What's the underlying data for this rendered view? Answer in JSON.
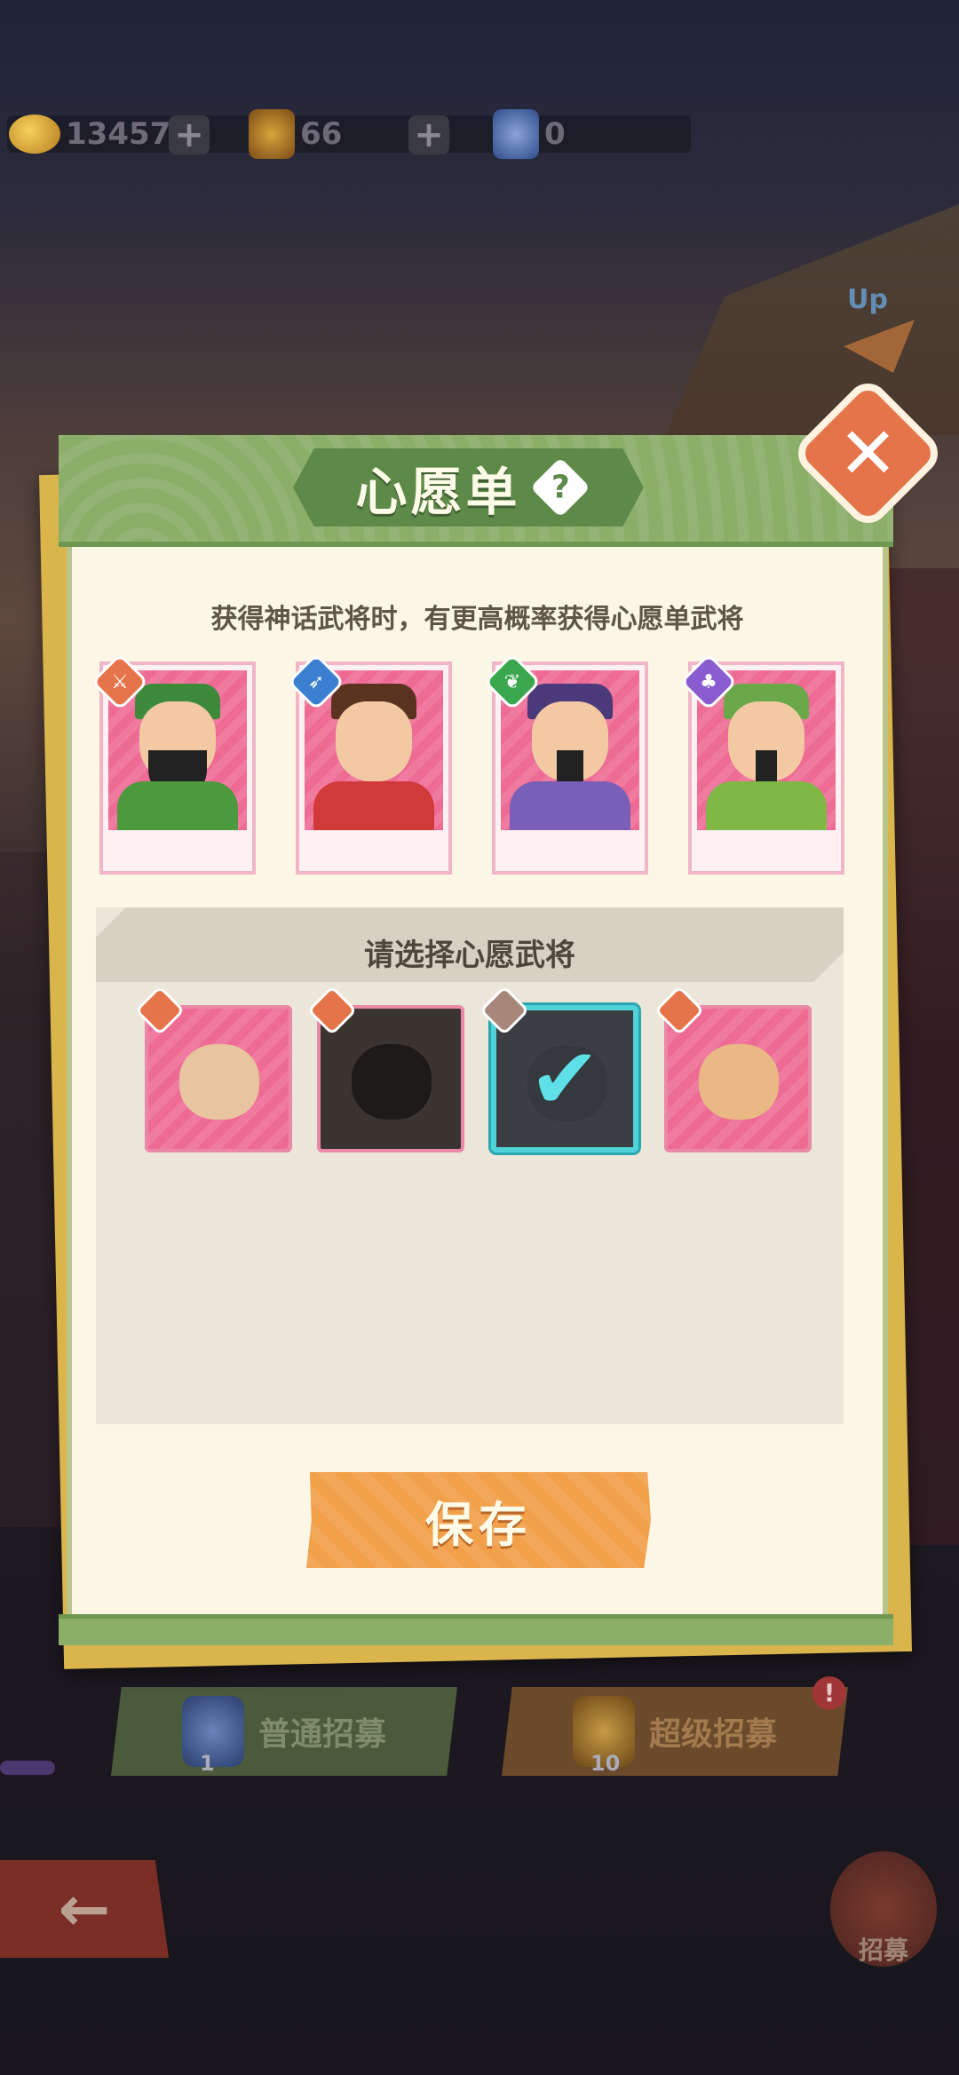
{
  "topbar": {
    "gold": "13457",
    "general_tokens": "66",
    "blue_tokens": "0"
  },
  "background": {
    "up_label": "Up"
  },
  "modal": {
    "title": "心愿单",
    "help": "?",
    "close": "✕",
    "subtitle": "获得神话武将时，有更高概率获得心愿单武将",
    "select_title": "请选择心愿武将",
    "save_label": "保存"
  },
  "bottom": {
    "normal_recruit": "普通招募",
    "normal_count": "1",
    "super_recruit": "超级招募",
    "super_count": "10",
    "alert": "!",
    "back": "←",
    "recruit_tab": "招募"
  },
  "colors": {
    "header_green": "#8bae69",
    "accent_orange": "#f2a04a",
    "close_orange": "#e5744a",
    "select_cyan": "#4fd3d8"
  }
}
